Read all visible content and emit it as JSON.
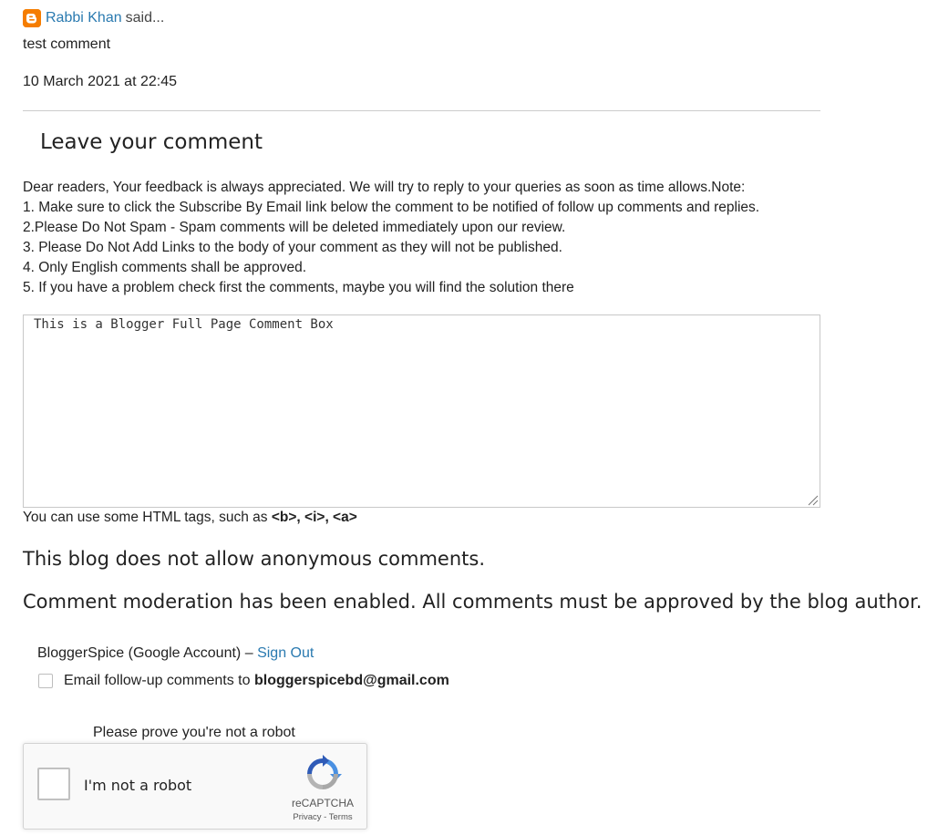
{
  "comment": {
    "author": "Rabbi Khan",
    "said": "said...",
    "body": "test comment",
    "timestamp": "10 March 2021 at 22:45",
    "icon": "blogger-icon"
  },
  "leave_comment": {
    "title": "Leave your comment",
    "message_lines": [
      "Dear readers, Your feedback is always appreciated. We will try to reply to your queries as soon as time allows.Note:",
      "1. Make sure to click the Subscribe By Email link below the comment to be notified of follow up comments and replies.",
      "2.Please Do Not Spam - Spam comments will be deleted immediately upon our review.",
      "3. Please Do Not Add Links to the body of your comment as they will not be published.",
      "4. Only English comments shall be approved.",
      "5. If you have a problem check first the comments, maybe you will find the solution there"
    ],
    "textarea_value": "This is a Blogger Full Page Comment Box",
    "html_hint_prefix": "You can use some HTML tags, such as",
    "html_hint_tags": "<b>, <i>, <a>"
  },
  "notices": {
    "anonymous": "This blog does not allow anonymous comments.",
    "moderation": "Comment moderation has been enabled. All comments must be approved by the blog author."
  },
  "account": {
    "name": "BloggerSpice (Google Account)",
    "separator": "–",
    "sign_out": "Sign Out"
  },
  "follow_up": {
    "label": "Email follow-up comments to",
    "email": "bloggerspicebd@gmail.com",
    "checked": false
  },
  "captcha": {
    "prompt": "Please prove you're not a robot",
    "label": "I'm not a robot",
    "brand": "reCAPTCHA",
    "links": "Privacy - Terms"
  },
  "colors": {
    "link": "#2a7ab0",
    "blogger_orange": "#f57d00",
    "recaptcha_blue": "#4a90e2"
  }
}
